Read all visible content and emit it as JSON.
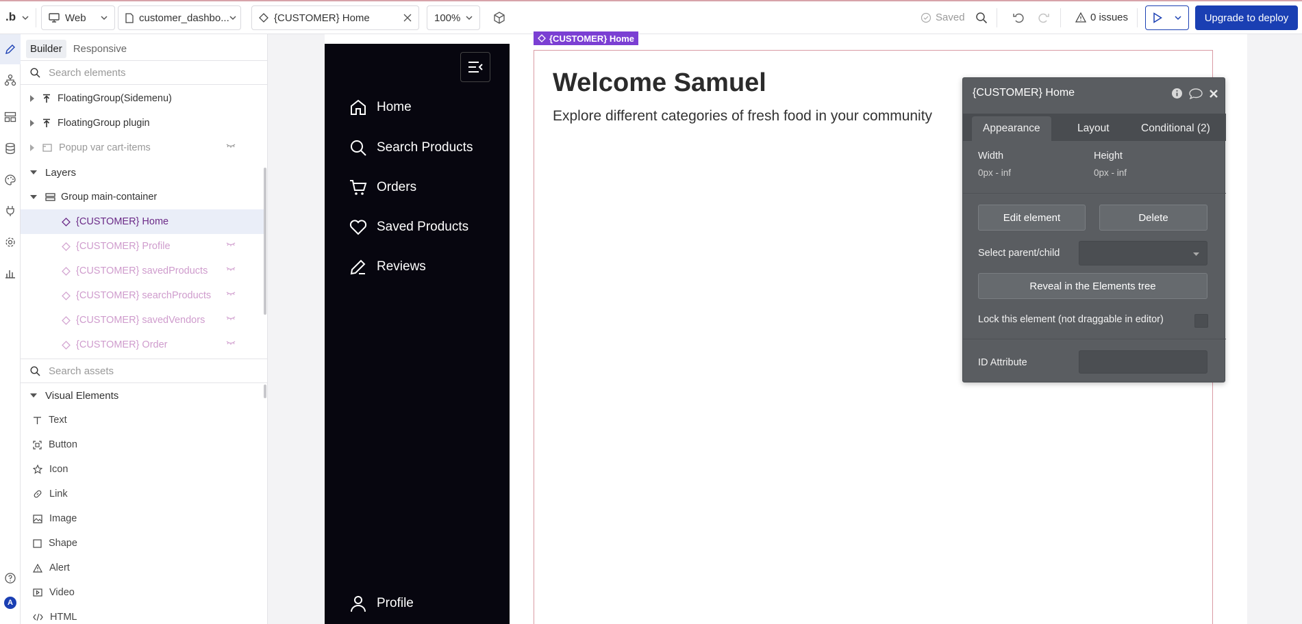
{
  "topbar": {
    "logo": ".b",
    "platform": "Web",
    "page_name": "customer_dashbo...",
    "element_name": "{CUSTOMER} Home",
    "zoom": "100%",
    "saved": "Saved",
    "issues": "0 issues",
    "deploy_label": "Upgrade to deploy",
    "accent": "#1a3fb3"
  },
  "leftpanel": {
    "tabs": [
      "Builder",
      "Responsive"
    ],
    "search_elements": "Search elements",
    "search_assets": "Search assets",
    "tree": [
      {
        "label": "FloatingGroup(Sidemenu)"
      },
      {
        "label": "FloatingGroup plugin"
      },
      {
        "label": "Popup var cart-items"
      },
      {
        "label": "Layers"
      },
      {
        "label": "Group main-container"
      },
      {
        "label": "{CUSTOMER} Home"
      },
      {
        "label": "{CUSTOMER} Profile"
      },
      {
        "label": "{CUSTOMER} savedProducts"
      },
      {
        "label": "{CUSTOMER} searchProducts"
      },
      {
        "label": "{CUSTOMER} savedVendors"
      },
      {
        "label": "{CUSTOMER} Order"
      }
    ],
    "assets_header": "Visual Elements",
    "assets": [
      "Text",
      "Button",
      "Icon",
      "Link",
      "Image",
      "Shape",
      "Alert",
      "Video",
      "HTML"
    ],
    "avatar": "A"
  },
  "canvas": {
    "selected_label": "{CUSTOMER} Home",
    "menu": [
      "Home",
      "Search Products",
      "Orders",
      "Saved Products",
      "Reviews",
      "Profile"
    ],
    "welcome": "Welcome Samuel",
    "subtitle": "Explore different categories of fresh food in your community"
  },
  "inspector": {
    "title": "{CUSTOMER} Home",
    "tabs": [
      "Appearance",
      "Layout",
      "Conditional (2)"
    ],
    "width_label": "Width",
    "width_value": "0px - inf",
    "height_label": "Height",
    "height_value": "0px - inf",
    "edit_button": "Edit element",
    "delete_button": "Delete",
    "select_parent": "Select parent/child",
    "reveal_button": "Reveal in the Elements tree",
    "lock_label": "Lock this element (not draggable in editor)",
    "id_attribute": "ID Attribute"
  }
}
